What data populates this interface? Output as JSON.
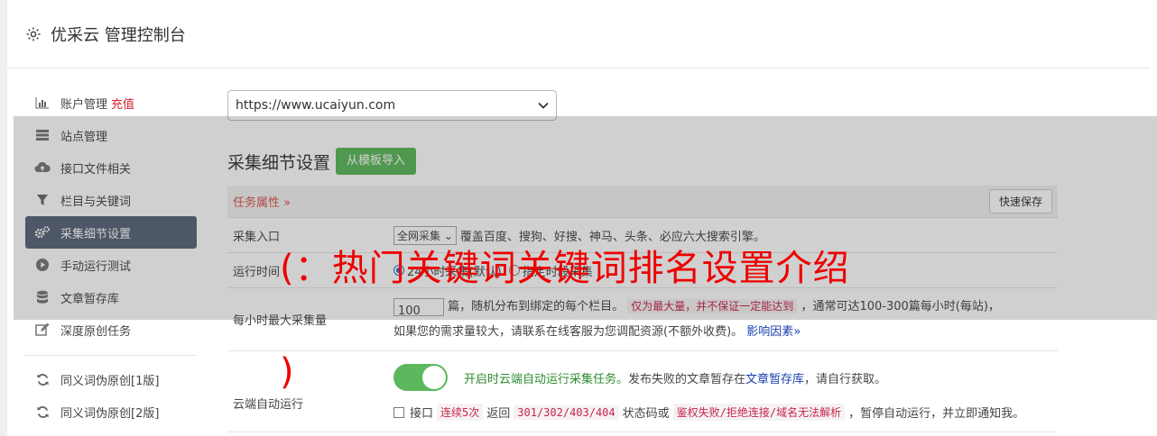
{
  "header": {
    "title": "优采云 管理控制台",
    "icon": "gear-icon"
  },
  "sidebar": {
    "items": [
      {
        "label": "账户管理",
        "extra": "充值",
        "icon": "bar-chart-icon"
      },
      {
        "label": "站点管理",
        "icon": "server-icon"
      },
      {
        "label": "接口文件相关",
        "icon": "cloud-upload-icon"
      },
      {
        "label": "栏目与关键词",
        "icon": "filter-icon"
      },
      {
        "label": "采集细节设置",
        "icon": "cogs-icon",
        "active": true
      },
      {
        "label": "手动运行测试",
        "icon": "play-circle-icon"
      },
      {
        "label": "文章暂存库",
        "icon": "database-icon"
      },
      {
        "label": "深度原创任务",
        "icon": "edit-icon"
      }
    ],
    "items2": [
      {
        "label": "同义词伪原创[1版]",
        "icon": "refresh-icon"
      },
      {
        "label": "同义词伪原创[2版]",
        "icon": "refresh-icon"
      }
    ]
  },
  "main": {
    "site_select": "https://www.ucaiyun.com",
    "section_title": "采集细节设置",
    "import_button": "从模板导入",
    "task_attr": "任务属性",
    "quick_save": "快速保存",
    "rows": {
      "entry": {
        "label": "采集入口",
        "select": "全网采集",
        "desc": "覆盖百度、搜狗、好搜、神马、头条、必应六大搜索引擎。"
      },
      "runtime": {
        "label": "运行时间",
        "opt1": "24小时采集(默认)",
        "opt2": "指定时段采集"
      },
      "max": {
        "label": "每小时最大采集量",
        "value": "100",
        "text1": "篇，随机分布到绑定的每个栏目。",
        "code": "仅为最大量，并不保证一定能达到",
        "text2": "，通常可达100-300篇每小时(每站)，",
        "text3": "如果您的需求量较大，请联系在线客服为您调配资源(不额外收费)。",
        "link": "影响因素"
      },
      "cloud": {
        "label": "云端自动运行",
        "green": "开启时云端自动运行采集任务。",
        "text1": "发布失败的文章暂存在",
        "link": "文章暂存库",
        "text2": "，请自行获取。",
        "chk_label": "接口",
        "code1": "连续5次",
        "t1": "返回",
        "code2": "301/302/403/404",
        "t2": "状态码或",
        "code3": "鉴权失败/拒绝连接/域名无法解析",
        "t3": "，暂停自动运行，并立即通知我。"
      }
    }
  },
  "overlay": {
    "text": "(：热门关键词关键词排名设置介绍",
    "paren": ")"
  },
  "colors": {
    "active_bg": "#596579",
    "green": "#5cb85c",
    "red": "#d9232e",
    "overlay_text": "#ee0000"
  }
}
